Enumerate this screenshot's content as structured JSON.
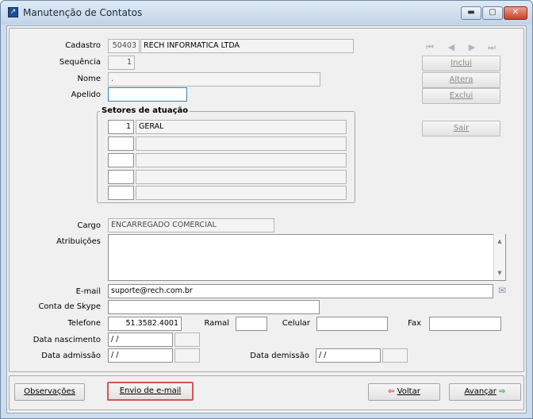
{
  "window": {
    "title": "Manutenção de Contatos",
    "controls": {
      "minimize": "▬",
      "maximize": "▢",
      "close": "✕"
    }
  },
  "nav_icons": [
    "first-icon",
    "prev-icon",
    "next-icon",
    "last-icon"
  ],
  "actions": {
    "inclui": "Inclui",
    "altera": "Altera",
    "exclui": "Exclui",
    "sair": "Sair"
  },
  "form": {
    "cadastro": {
      "label": "Cadastro",
      "code": "50403",
      "name": "RECH INFORMATICA LTDA"
    },
    "sequencia": {
      "label": "Sequência",
      "value": "1"
    },
    "nome": {
      "label": "Nome",
      "value": "."
    },
    "apelido": {
      "label": "Apelido",
      "value": ""
    },
    "setores": {
      "title": "Setores de atuação",
      "rows": [
        {
          "code": "1",
          "name": "GERAL"
        },
        {
          "code": "",
          "name": ""
        },
        {
          "code": "",
          "name": ""
        },
        {
          "code": "",
          "name": ""
        },
        {
          "code": "",
          "name": ""
        }
      ]
    },
    "cargo": {
      "label": "Cargo",
      "value": "ENCARREGADO COMERCIAL"
    },
    "atribuicoes": {
      "label": "Atribuições",
      "value": ""
    },
    "email": {
      "label": "E-mail",
      "value": "suporte@rech.com.br"
    },
    "skype": {
      "label": "Conta de Skype",
      "value": ""
    },
    "telefone": {
      "label": "Telefone",
      "value": "51.3582.4001"
    },
    "ramal": {
      "label": "Ramal",
      "value": ""
    },
    "celular": {
      "label": "Celular",
      "value": ""
    },
    "fax": {
      "label": "Fax",
      "value": ""
    },
    "nascimento": {
      "label": "Data nascimento",
      "value": "/ /",
      "extra": ""
    },
    "admissao": {
      "label": "Data admissão",
      "value": "/ /",
      "extra": ""
    },
    "demissao": {
      "label": "Data demissão",
      "value": "/ /",
      "extra": ""
    }
  },
  "footer": {
    "observacoes": "Observações",
    "envio": "Envio de e-mail",
    "voltar": "Voltar",
    "avancar": "Avançar"
  },
  "colors": {
    "focus_border": "#d9534f",
    "back_arrow": "#d83a1e",
    "forward_arrow": "#29a02a"
  }
}
